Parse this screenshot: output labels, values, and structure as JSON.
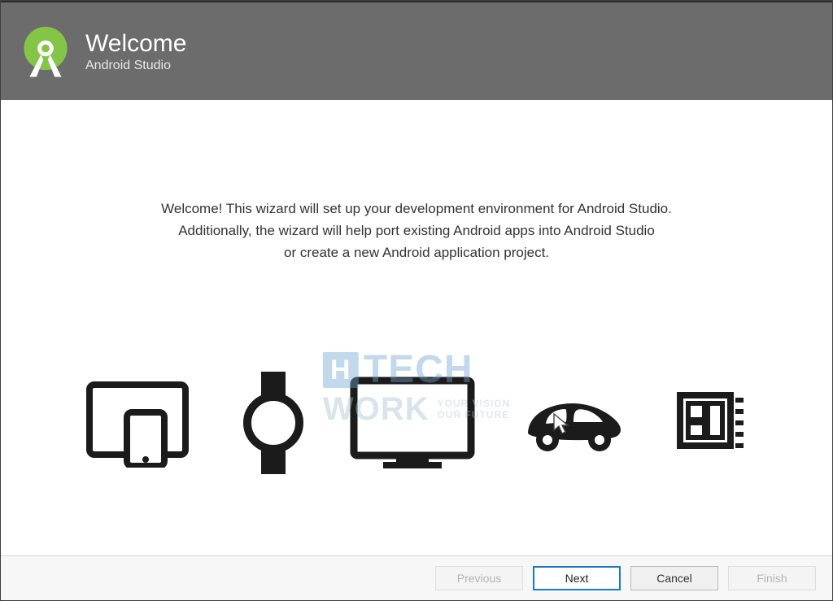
{
  "header": {
    "title": "Welcome",
    "subtitle": "Android Studio"
  },
  "welcome": {
    "line1": "Welcome! This wizard will set up your development environment for Android Studio.",
    "line2": "Additionally, the wizard will help port existing Android apps into Android Studio",
    "line3": "or create a new Android application project."
  },
  "watermark": {
    "brand_part1": "HI",
    "brand_part2": "TECH",
    "brand2": "WORK",
    "tag1": "YOUR VISION",
    "tag2": "OUR FUTURE"
  },
  "icons": {
    "devices": "phone-tablet-icon",
    "watch": "watch-icon",
    "tv": "tv-icon",
    "car": "car-icon",
    "chip": "embedded-chip-icon"
  },
  "buttons": {
    "previous": "Previous",
    "next": "Next",
    "cancel": "Cancel",
    "finish": "Finish"
  }
}
